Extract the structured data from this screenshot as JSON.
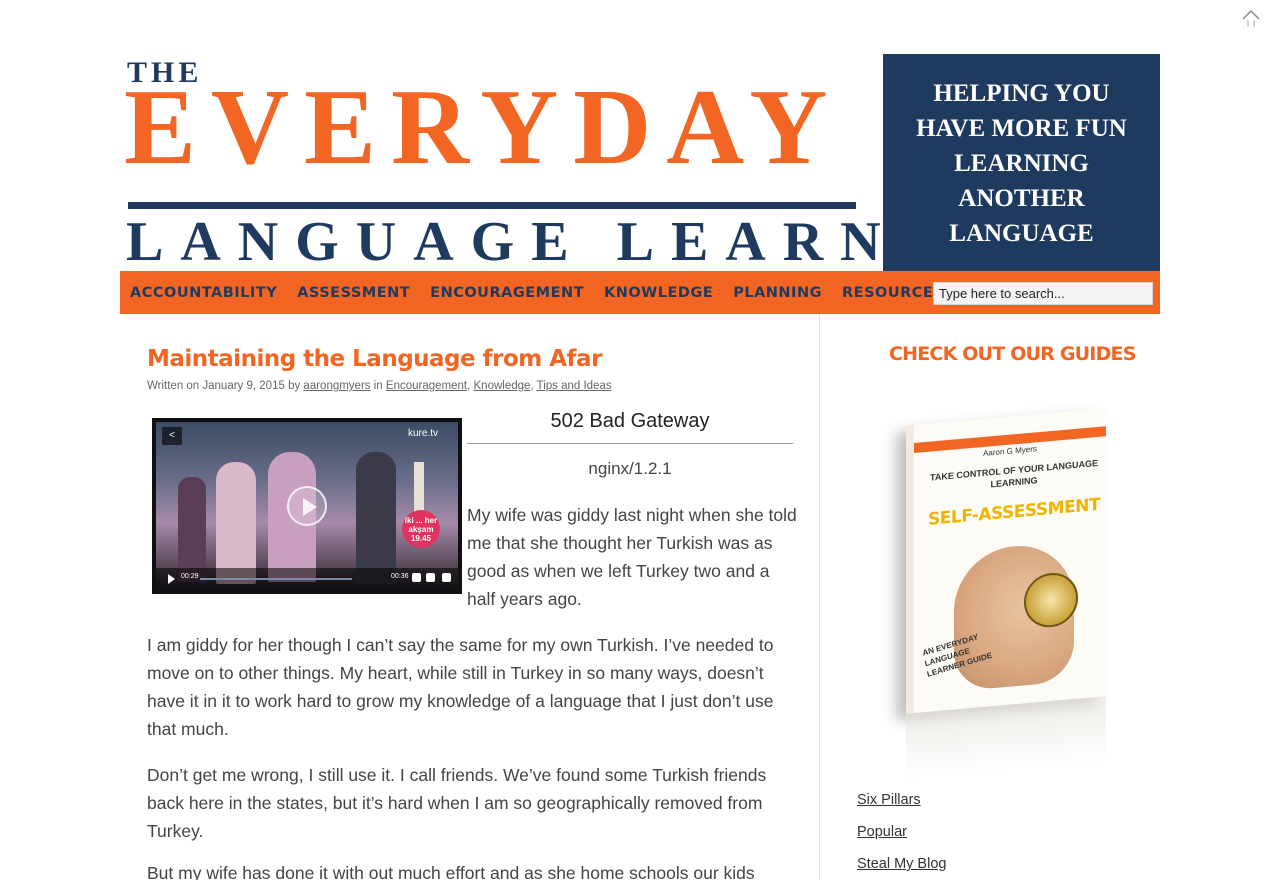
{
  "header": {
    "logo_the": "THE",
    "logo_everyday": "EVERYDAY",
    "logo_language_learner": "LANGUAGE LEARNER",
    "tagline": "HELPING YOU HAVE MORE FUN LEARNING ANOTHER LANGUAGE"
  },
  "nav": {
    "items": [
      "ACCOUNTABILITY",
      "ASSESSMENT",
      "ENCOURAGEMENT",
      "KNOWLEDGE",
      "PLANNING",
      "RESOURCES"
    ],
    "search_placeholder": "Type here to search..."
  },
  "post": {
    "title": "Maintaining the Language from Afar",
    "meta": {
      "written_on": "Written on January 9, 2015 by",
      "author": "aarongmyers",
      "in": "in",
      "categories": [
        "Encouragement",
        "Knowledge",
        "Tips and Ideas"
      ]
    },
    "video": {
      "brand": "kure.tv",
      "time_elapsed": "00:29",
      "time_total": "00:36",
      "badge": "iki ... her akşam 19.45"
    },
    "error_title": "502 Bad Gateway",
    "error_server": "nginx/1.2.1",
    "paragraphs": [
      "My wife was giddy last night when she told me that she thought her Turkish was as good as when we left Turkey two and a half years ago.",
      "I am giddy for her though I can’t say the same for my own Turkish.  I’ve needed to move on to other things.  My heart, while still in Turkey in so many ways, doesn’t have it in it to work hard to grow my knowledge of a language that I just don’t use that much.",
      "Don’t get me wrong, I still use it.  I call friends. We’ve found some Turkish friends back here in the states, but it’s hard when I am so geographically removed from Turkey.",
      "But my wife has done it with out much effort and as she home schools our kids"
    ]
  },
  "sidebar": {
    "heading": "CHECK OUT OUR GUIDES",
    "book": {
      "author": "Aaron G Myers",
      "subtitle": "TAKE CONTROL OF YOUR LANGUAGE LEARNING",
      "title": "SELF-ASSESSMENT",
      "series": "AN EVERYDAY LANGUAGE LEARNER GUIDE"
    },
    "links": [
      "Six Pillars",
      "Popular",
      "Steal My Blog"
    ]
  },
  "colors": {
    "brand_orange": "#f26522",
    "brand_navy": "#1f3a5f"
  }
}
